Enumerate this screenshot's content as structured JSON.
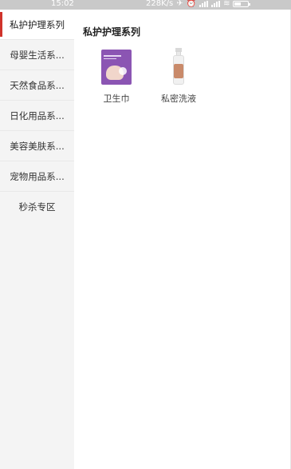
{
  "status_bar": {
    "time": "15:02",
    "speed": "228K/s",
    "icons": [
      "sync-icon",
      "alarm-icon",
      "signal-icon",
      "signal-icon",
      "wifi-icon",
      "battery-icon"
    ]
  },
  "sidebar": {
    "items": [
      {
        "label": "私护护理系列",
        "active": true
      },
      {
        "label": "母婴生活系..."
      },
      {
        "label": "天然食品系..."
      },
      {
        "label": "日化用品系..."
      },
      {
        "label": "美容美肤系..."
      },
      {
        "label": "宠物用品系..."
      },
      {
        "label": "秒杀专区"
      }
    ]
  },
  "main": {
    "title": "私护护理系列",
    "products": [
      {
        "name": "卫生巾",
        "icon": "sanitary-pad-box-image"
      },
      {
        "name": "私密洗液",
        "icon": "intimate-wash-bottle-image"
      }
    ]
  },
  "colors": {
    "accent": "#d0332b",
    "sidebar_bg": "#f4f4f4",
    "status_bar_bg": "#c9c9c9"
  }
}
